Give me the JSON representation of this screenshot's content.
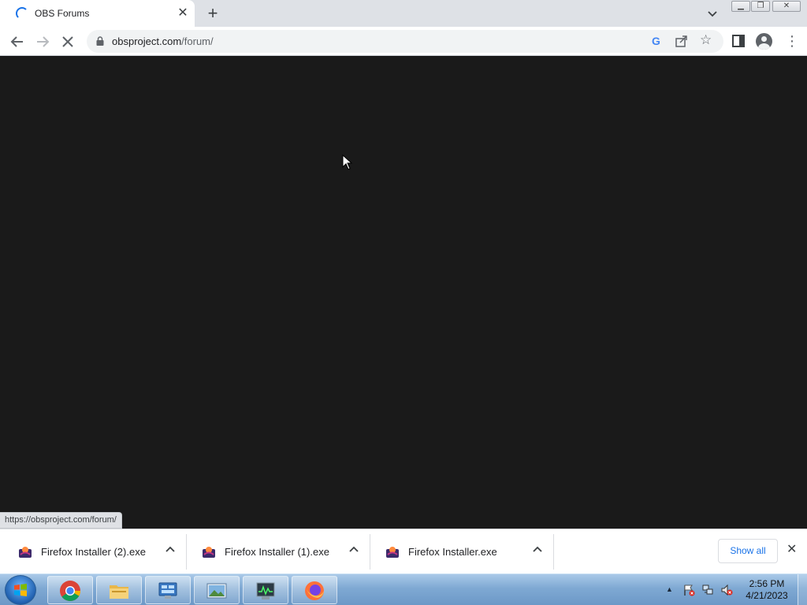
{
  "browser": {
    "tab": {
      "title": "OBS Forums"
    },
    "address_bar": {
      "url_host": "obsproject.com",
      "url_path": "/forum/"
    },
    "status_bubble": "https://obsproject.com/forum/"
  },
  "icons": {
    "tab_loading": "spinner-icon",
    "tab_close": "close-icon",
    "new_tab": "plus-icon",
    "tab_search": "chevron-down-icon",
    "back": "arrow-left-icon",
    "forward": "arrow-right-icon",
    "stop": "x-icon",
    "lock": "lock-icon",
    "google": "google-g-icon",
    "share": "share-icon",
    "bookmark": "star-icon",
    "side_panel": "side-panel-icon",
    "profile": "profile-icon",
    "menu": "kebab-menu-icon"
  },
  "downloads": {
    "items": [
      {
        "name": "Firefox Installer (2).exe"
      },
      {
        "name": "Firefox Installer (1).exe"
      },
      {
        "name": "Firefox Installer.exe"
      }
    ],
    "show_all_label": "Show all"
  },
  "taskbar": {
    "apps": [
      "chrome",
      "file-explorer",
      "control-panel",
      "photo-viewer",
      "task-manager",
      "firefox"
    ],
    "clock": {
      "time": "2:56 PM",
      "date": "4/21/2023"
    }
  },
  "colors": {
    "page_background": "#1a1a1a",
    "accent": "#1a73e8",
    "tab_strip": "#dee1e6"
  }
}
